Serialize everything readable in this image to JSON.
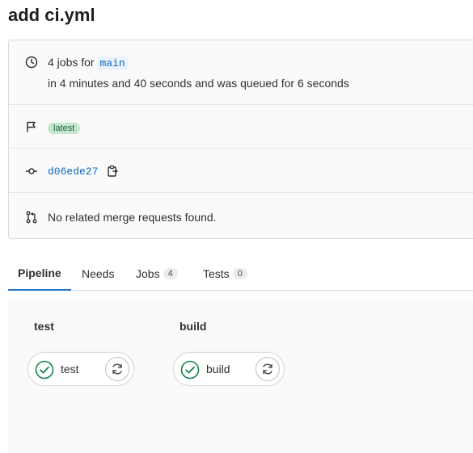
{
  "header": {
    "title": "add ci.yml"
  },
  "info": {
    "jobs_prefix": "4 jobs for",
    "branch": "main",
    "duration": "in 4 minutes and 40 seconds and was queued for 6 seconds",
    "badge": "latest",
    "commit_sha": "d06ede27",
    "merge_requests": "No related merge requests found.",
    "icons": [
      "clock-icon",
      "flag-icon",
      "commit-icon",
      "copy-icon",
      "merge-request-icon"
    ]
  },
  "tabs": [
    {
      "label": "Pipeline",
      "active": true
    },
    {
      "label": "Needs"
    },
    {
      "label": "Jobs",
      "count": "4"
    },
    {
      "label": "Tests",
      "count": "0"
    }
  ],
  "graph": {
    "stages": [
      {
        "title": "test",
        "job": {
          "name": "test",
          "status": "success",
          "action": "retry"
        }
      },
      {
        "title": "build",
        "job": {
          "name": "build",
          "status": "success",
          "action": "retry"
        }
      }
    ]
  },
  "colors": {
    "link": "#1068bf",
    "success": "#108548",
    "badge_bg": "#c3e6cd",
    "tab_active": "#1f75cb"
  }
}
